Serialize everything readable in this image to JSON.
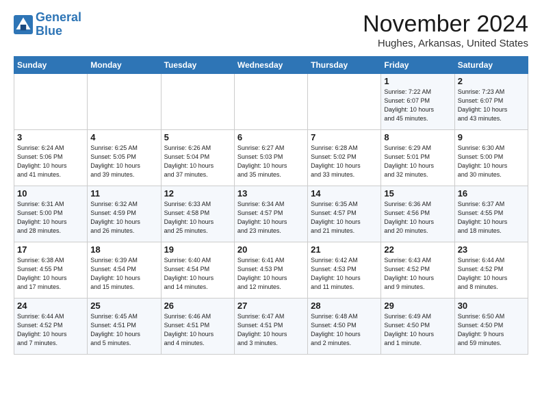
{
  "logo": {
    "line1": "General",
    "line2": "Blue"
  },
  "title": "November 2024",
  "location": "Hughes, Arkansas, United States",
  "days_of_week": [
    "Sunday",
    "Monday",
    "Tuesday",
    "Wednesday",
    "Thursday",
    "Friday",
    "Saturday"
  ],
  "weeks": [
    [
      {
        "day": "",
        "info": ""
      },
      {
        "day": "",
        "info": ""
      },
      {
        "day": "",
        "info": ""
      },
      {
        "day": "",
        "info": ""
      },
      {
        "day": "",
        "info": ""
      },
      {
        "day": "1",
        "info": "Sunrise: 7:22 AM\nSunset: 6:07 PM\nDaylight: 10 hours\nand 45 minutes."
      },
      {
        "day": "2",
        "info": "Sunrise: 7:23 AM\nSunset: 6:07 PM\nDaylight: 10 hours\nand 43 minutes."
      }
    ],
    [
      {
        "day": "3",
        "info": "Sunrise: 6:24 AM\nSunset: 5:06 PM\nDaylight: 10 hours\nand 41 minutes."
      },
      {
        "day": "4",
        "info": "Sunrise: 6:25 AM\nSunset: 5:05 PM\nDaylight: 10 hours\nand 39 minutes."
      },
      {
        "day": "5",
        "info": "Sunrise: 6:26 AM\nSunset: 5:04 PM\nDaylight: 10 hours\nand 37 minutes."
      },
      {
        "day": "6",
        "info": "Sunrise: 6:27 AM\nSunset: 5:03 PM\nDaylight: 10 hours\nand 35 minutes."
      },
      {
        "day": "7",
        "info": "Sunrise: 6:28 AM\nSunset: 5:02 PM\nDaylight: 10 hours\nand 33 minutes."
      },
      {
        "day": "8",
        "info": "Sunrise: 6:29 AM\nSunset: 5:01 PM\nDaylight: 10 hours\nand 32 minutes."
      },
      {
        "day": "9",
        "info": "Sunrise: 6:30 AM\nSunset: 5:00 PM\nDaylight: 10 hours\nand 30 minutes."
      }
    ],
    [
      {
        "day": "10",
        "info": "Sunrise: 6:31 AM\nSunset: 5:00 PM\nDaylight: 10 hours\nand 28 minutes."
      },
      {
        "day": "11",
        "info": "Sunrise: 6:32 AM\nSunset: 4:59 PM\nDaylight: 10 hours\nand 26 minutes."
      },
      {
        "day": "12",
        "info": "Sunrise: 6:33 AM\nSunset: 4:58 PM\nDaylight: 10 hours\nand 25 minutes."
      },
      {
        "day": "13",
        "info": "Sunrise: 6:34 AM\nSunset: 4:57 PM\nDaylight: 10 hours\nand 23 minutes."
      },
      {
        "day": "14",
        "info": "Sunrise: 6:35 AM\nSunset: 4:57 PM\nDaylight: 10 hours\nand 21 minutes."
      },
      {
        "day": "15",
        "info": "Sunrise: 6:36 AM\nSunset: 4:56 PM\nDaylight: 10 hours\nand 20 minutes."
      },
      {
        "day": "16",
        "info": "Sunrise: 6:37 AM\nSunset: 4:55 PM\nDaylight: 10 hours\nand 18 minutes."
      }
    ],
    [
      {
        "day": "17",
        "info": "Sunrise: 6:38 AM\nSunset: 4:55 PM\nDaylight: 10 hours\nand 17 minutes."
      },
      {
        "day": "18",
        "info": "Sunrise: 6:39 AM\nSunset: 4:54 PM\nDaylight: 10 hours\nand 15 minutes."
      },
      {
        "day": "19",
        "info": "Sunrise: 6:40 AM\nSunset: 4:54 PM\nDaylight: 10 hours\nand 14 minutes."
      },
      {
        "day": "20",
        "info": "Sunrise: 6:41 AM\nSunset: 4:53 PM\nDaylight: 10 hours\nand 12 minutes."
      },
      {
        "day": "21",
        "info": "Sunrise: 6:42 AM\nSunset: 4:53 PM\nDaylight: 10 hours\nand 11 minutes."
      },
      {
        "day": "22",
        "info": "Sunrise: 6:43 AM\nSunset: 4:52 PM\nDaylight: 10 hours\nand 9 minutes."
      },
      {
        "day": "23",
        "info": "Sunrise: 6:44 AM\nSunset: 4:52 PM\nDaylight: 10 hours\nand 8 minutes."
      }
    ],
    [
      {
        "day": "24",
        "info": "Sunrise: 6:44 AM\nSunset: 4:52 PM\nDaylight: 10 hours\nand 7 minutes."
      },
      {
        "day": "25",
        "info": "Sunrise: 6:45 AM\nSunset: 4:51 PM\nDaylight: 10 hours\nand 5 minutes."
      },
      {
        "day": "26",
        "info": "Sunrise: 6:46 AM\nSunset: 4:51 PM\nDaylight: 10 hours\nand 4 minutes."
      },
      {
        "day": "27",
        "info": "Sunrise: 6:47 AM\nSunset: 4:51 PM\nDaylight: 10 hours\nand 3 minutes."
      },
      {
        "day": "28",
        "info": "Sunrise: 6:48 AM\nSunset: 4:50 PM\nDaylight: 10 hours\nand 2 minutes."
      },
      {
        "day": "29",
        "info": "Sunrise: 6:49 AM\nSunset: 4:50 PM\nDaylight: 10 hours\nand 1 minute."
      },
      {
        "day": "30",
        "info": "Sunrise: 6:50 AM\nSunset: 4:50 PM\nDaylight: 9 hours\nand 59 minutes."
      }
    ]
  ]
}
